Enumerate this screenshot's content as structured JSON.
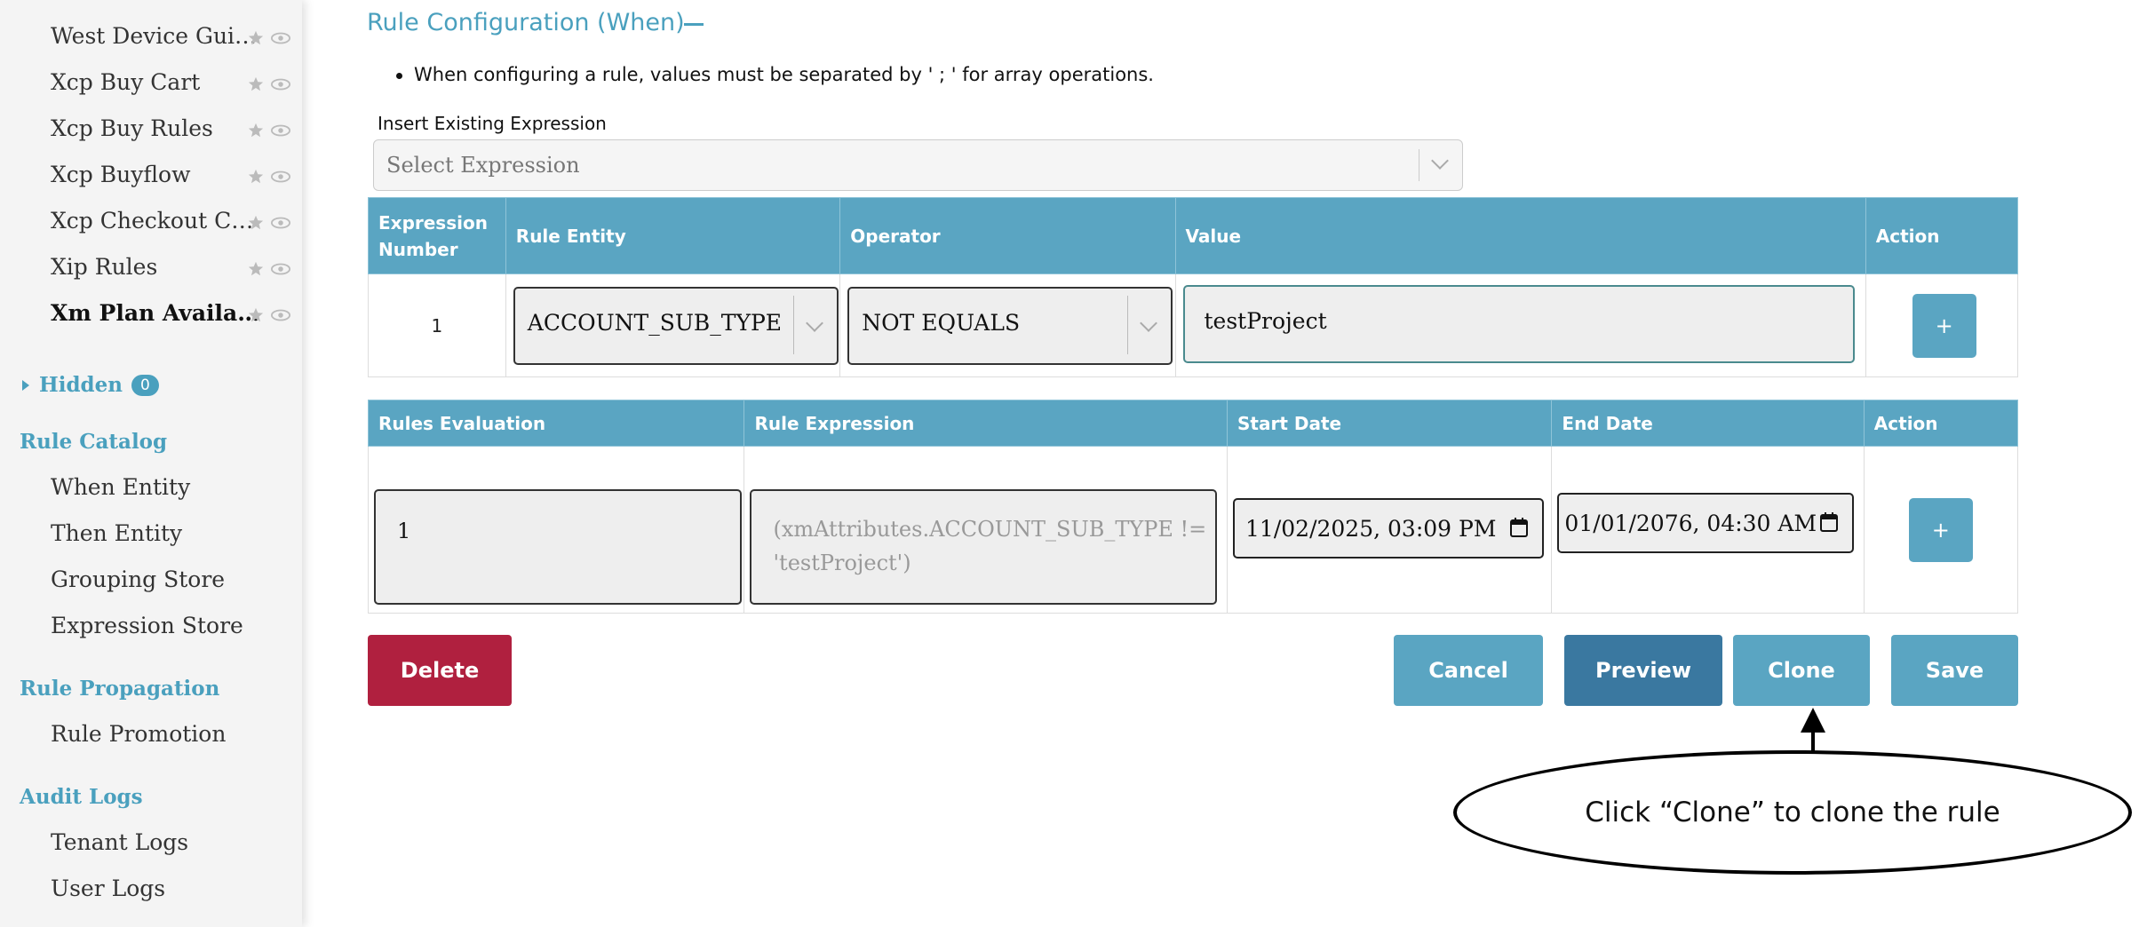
{
  "sidebar": {
    "items": [
      {
        "label": "West Device Gui…",
        "active": false
      },
      {
        "label": "Xcp Buy Cart",
        "active": false
      },
      {
        "label": "Xcp Buy Rules",
        "active": false
      },
      {
        "label": "Xcp Buyflow",
        "active": false
      },
      {
        "label": "Xcp Checkout C…",
        "active": false
      },
      {
        "label": "Xip Rules",
        "active": false
      },
      {
        "label": "Xm Plan Availa…",
        "active": true
      }
    ],
    "hidden": {
      "label": "Hidden",
      "count": "0"
    },
    "sections": [
      {
        "title": "Rule Catalog",
        "items": [
          "When Entity",
          "Then Entity",
          "Grouping Store",
          "Expression Store"
        ]
      },
      {
        "title": "Rule Propagation",
        "items": [
          "Rule Promotion"
        ]
      },
      {
        "title": "Audit Logs",
        "items": [
          "Tenant Logs",
          "User Logs"
        ]
      }
    ]
  },
  "main": {
    "title": "Rule Configuration (When)",
    "note": "When configuring a rule, values must be separated by ' ; ' for array operations.",
    "insert_label": "Insert Existing Expression",
    "select_placeholder": "Select Expression",
    "expr_table": {
      "headers": [
        "Expression Number",
        "Rule Entity",
        "Operator",
        "Value",
        "Action"
      ],
      "row": {
        "number": "1",
        "entity": "ACCOUNT_SUB_TYPE",
        "operator": "NOT EQUALS",
        "value": "testProject",
        "action": "+"
      }
    },
    "eval_table": {
      "headers": [
        "Rules Evaluation",
        "Rule Expression",
        "Start Date",
        "End Date",
        "Action"
      ],
      "row": {
        "evaluation": "1",
        "expression_line1": "(xmAttributes.ACCOUNT_SUB_TYPE !=",
        "expression_line2": "'testProject')",
        "start_date": "11/02/2025, 03:09  PM",
        "end_date": "01/01/2076, 04:30  AM",
        "action": "+"
      }
    },
    "buttons": {
      "delete": "Delete",
      "cancel": "Cancel",
      "preview": "Preview",
      "clone": "Clone",
      "save": "Save"
    },
    "colors": {
      "accent": "#5aa5c2",
      "delete": "#b0203f",
      "preview": "#3a78a0"
    }
  },
  "callout": {
    "text": "Click “Clone” to clone the rule"
  }
}
